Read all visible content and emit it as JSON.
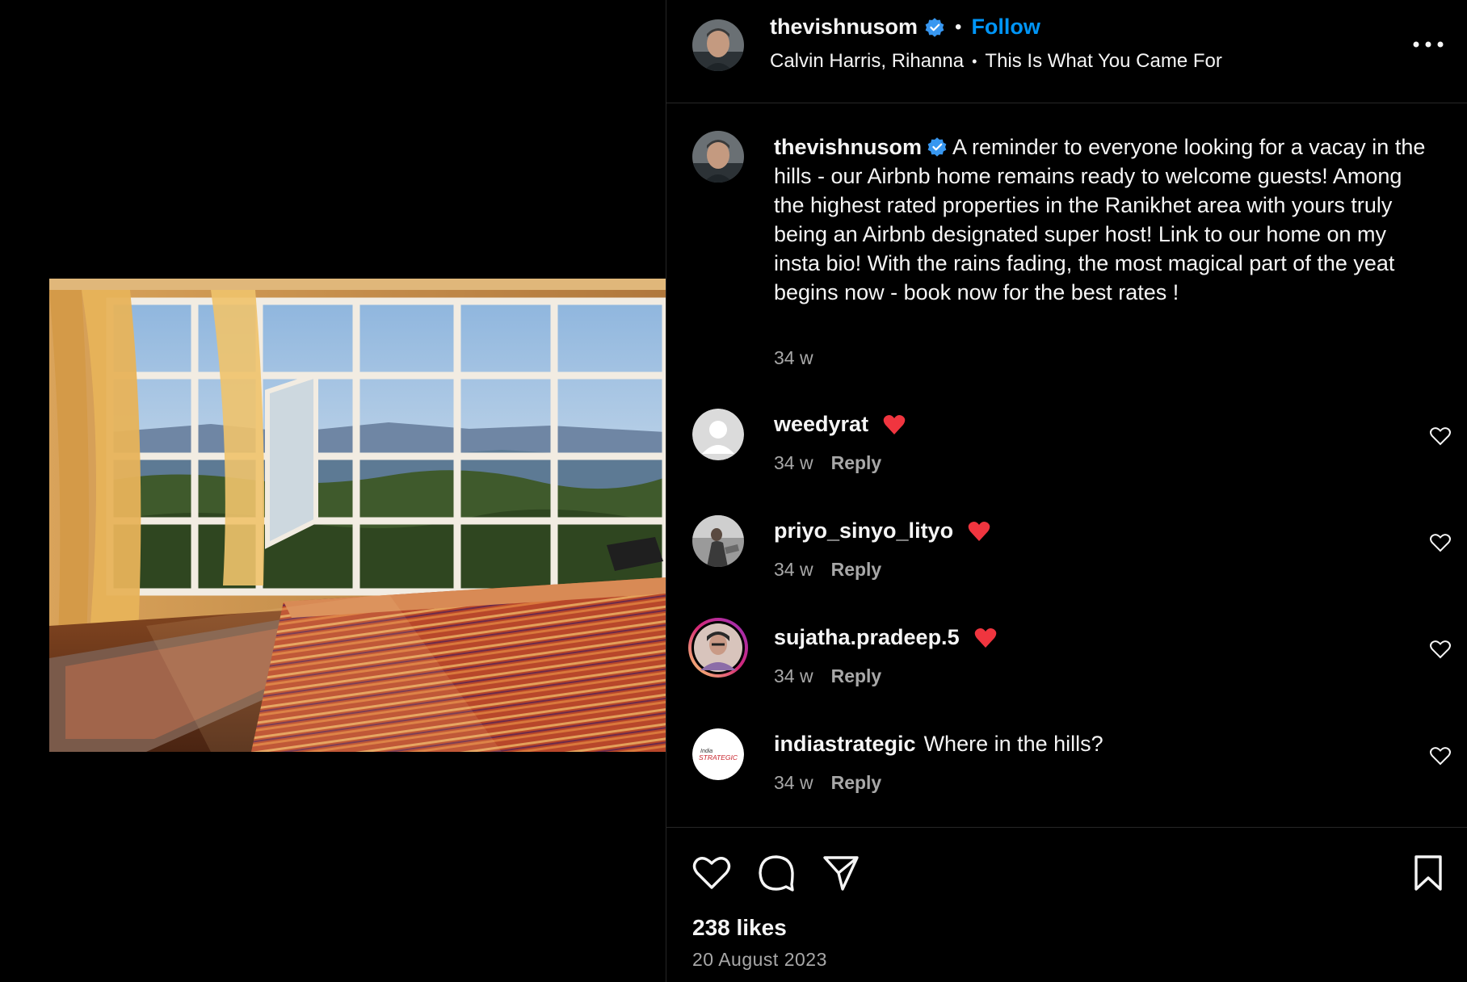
{
  "post": {
    "author": "thevishnusom",
    "follow_label": "Follow",
    "audio": {
      "artists": "Calvin Harris, Rihanna",
      "track": "This Is What You Came For"
    },
    "caption": "A reminder to everyone looking for a vacay in the hills - our Airbnb home remains ready to welcome guests! Among the highest rated properties in the Ranikhet area with yours truly being an Airbnb designated super host! Link to our home on my insta bio! With the rains fading, the most magical part of the yeat begins now - book now for the best rates !",
    "caption_time": "34 w",
    "likes": "238 likes",
    "date": "20 August 2023"
  },
  "comments": [
    {
      "user": "weedyrat",
      "text": "",
      "emoji": "red-heart",
      "time": "34 w",
      "reply": "Reply"
    },
    {
      "user": "priyo_sinyo_lityo",
      "text": "",
      "emoji": "red-heart",
      "time": "34 w",
      "reply": "Reply"
    },
    {
      "user": "sujatha.pradeep.5",
      "text": "",
      "emoji": "red-heart",
      "time": "34 w",
      "reply": "Reply"
    },
    {
      "user": "indiastrategic",
      "text": "Where in the hills?",
      "emoji": "",
      "time": "34 w",
      "reply": "Reply"
    }
  ],
  "avatars": {
    "indiastrategic_logo_line1": "India",
    "indiastrategic_logo_line2": "STRATEGIC"
  },
  "colors": {
    "background": "#000000",
    "text": "#f5f5f5",
    "secondary_text": "#a8a8a8",
    "follow_blue": "#0095f6",
    "verified_blue": "#3897f0",
    "divider": "#262626"
  },
  "icons": [
    "verified-badge-icon",
    "more-options-icon",
    "heart-icon",
    "comment-icon",
    "share-icon",
    "bookmark-icon",
    "red-heart-emoji"
  ]
}
